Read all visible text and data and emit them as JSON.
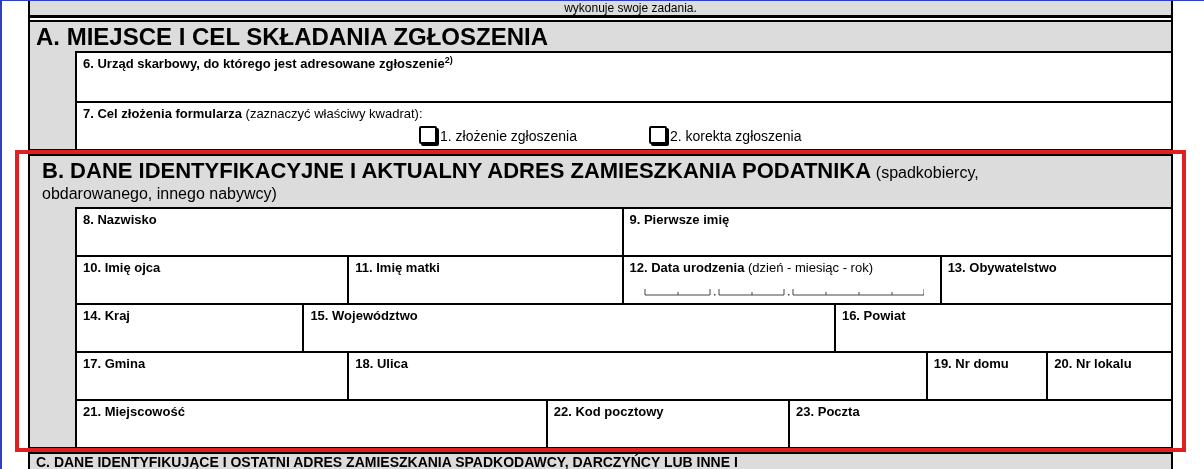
{
  "top_text": "wykonuje swoje zadania.",
  "sections": [
    {
      "title": "A. MIEJSCE I CEL SKŁADANIA ZGŁOSZENIA",
      "lines": [
        {
          "fields": [
            {
              "kind": "text",
              "label": "6. Urząd skarbowy, do którego jest adresowane zgłoszenie$^{2)}$"
            }
          ]
        },
        {
          "fields": [
            {
              "kind": "choice",
              "label": "7. Cel złożenia formularza",
              "note": "(zaznaczyć właściwy kwadrat):",
              "options": [
                {
                  "label": "1. złożenie zgłoszenia",
                  "checked": false
                },
                {
                  "label": "2. korekta zgłoszenia",
                  "checked": false
                }
              ]
            }
          ]
        }
      ]
    },
    {
      "title": "B. DANE IDENTYFIKACYJNE I AKTUALNY ADRES ZAMIESZKANIA PODATNIKA",
      "note": "(spadkobiercy, obdarowanego, innego nabywcy)",
      "lines": [
        {
          "fields": [
            {
              "kind": "text",
              "label": "8. Nazwisko"
            },
            {
              "kind": "text",
              "label": "9. Pierwsze imię"
            }
          ]
        },
        {
          "fields": [
            {
              "kind": "text",
              "label": "10. Imię ojca"
            },
            {
              "kind": "text",
              "label": "11. Imię matki"
            },
            {
              "kind": "date",
              "label": "12. Data urodzenia",
              "note": "(dzień - miesiąc - rok)"
            },
            {
              "kind": "text",
              "label": "13. Obywatelstwo"
            }
          ]
        },
        {
          "fields": [
            {
              "kind": "text",
              "label": "14. Kraj"
            },
            {
              "kind": "text",
              "label": "15. Województwo"
            },
            {
              "kind": "text",
              "label": "16. Powiat"
            }
          ]
        },
        {
          "fields": [
            {
              "kind": "text",
              "label": "17. Gmina"
            },
            {
              "kind": "text",
              "label": "18. Ulica"
            },
            {
              "kind": "text",
              "label": "19. Nr domu"
            },
            {
              "kind": "text",
              "label": "20. Nr lokalu"
            }
          ]
        },
        {
          "fields": [
            {
              "kind": "text",
              "label": "21. Miejscowość"
            },
            {
              "kind": "text",
              "label": "22. Kod pocztowy"
            },
            {
              "kind": "text",
              "label": "23. Poczta"
            }
          ]
        }
      ]
    },
    {
      "title": "C. DANE IDENTYFIKUJĄCE I OSTATNI ADRES ZAMIESZKANIA SPADKODAWCY, DARCZYŃCY LUB INNE I"
    }
  ]
}
